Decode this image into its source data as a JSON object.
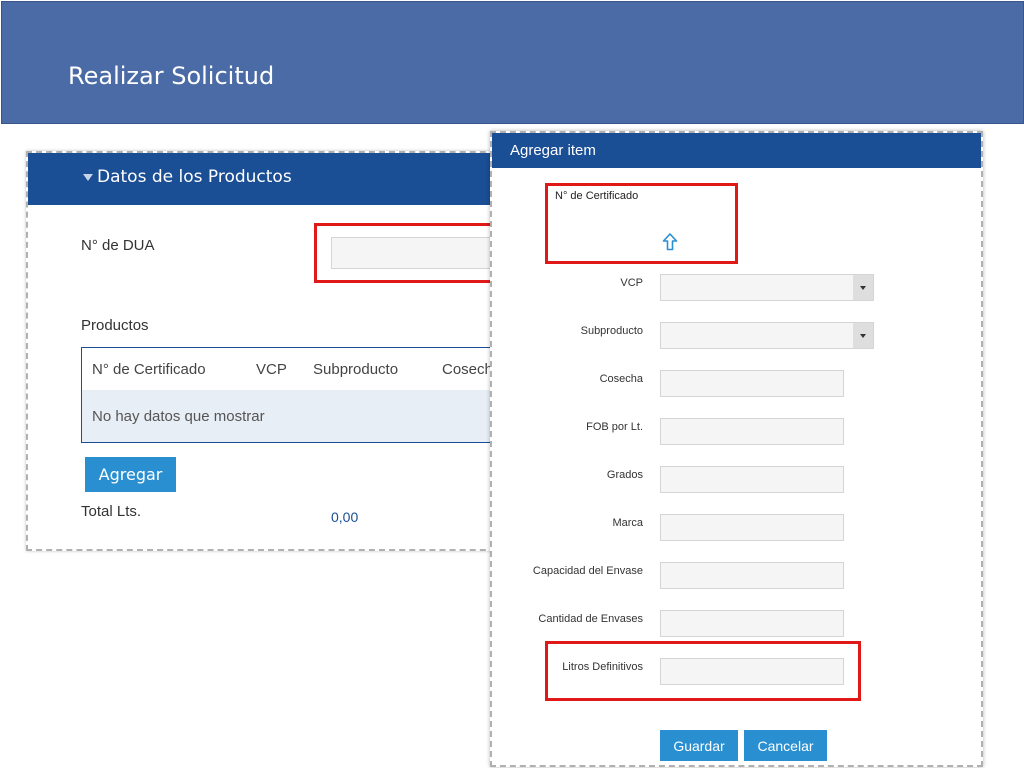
{
  "header": {
    "title": "Realizar Solicitud"
  },
  "products_panel": {
    "title": "Datos de los Productos",
    "dua_label": "N° de DUA",
    "dua_value": "",
    "productos_label": "Productos",
    "grid": {
      "columns": [
        "N° de Certificado",
        "VCP",
        "Subproducto",
        "Cosecha"
      ],
      "empty_text": "No hay datos que mostrar"
    },
    "add_button": "Agregar",
    "total_label": "Total Lts.",
    "total_value": "0,00"
  },
  "modal": {
    "title": "Agregar item",
    "cert_label": "N° de Certificado",
    "upload_icon": "upload-arrow-icon",
    "fields": {
      "vcp": {
        "label": "VCP",
        "value": ""
      },
      "subproducto": {
        "label": "Subproducto",
        "value": ""
      },
      "cosecha": {
        "label": "Cosecha",
        "value": ""
      },
      "fob": {
        "label": "FOB por Lt.",
        "value": ""
      },
      "grados": {
        "label": "Grados",
        "value": ""
      },
      "marca": {
        "label": "Marca",
        "value": ""
      },
      "capacidad": {
        "label": "Capacidad del Envase",
        "value": ""
      },
      "cantidad": {
        "label": "Cantidad de Envases",
        "value": ""
      },
      "litros": {
        "label": "Litros Definitivos",
        "value": ""
      }
    },
    "save_button": "Guardar",
    "cancel_button": "Cancelar"
  },
  "colors": {
    "header_bg": "#4a6ba5",
    "panel_header": "#1a4e95",
    "button": "#2a8fd0",
    "highlight": "#e01818"
  }
}
